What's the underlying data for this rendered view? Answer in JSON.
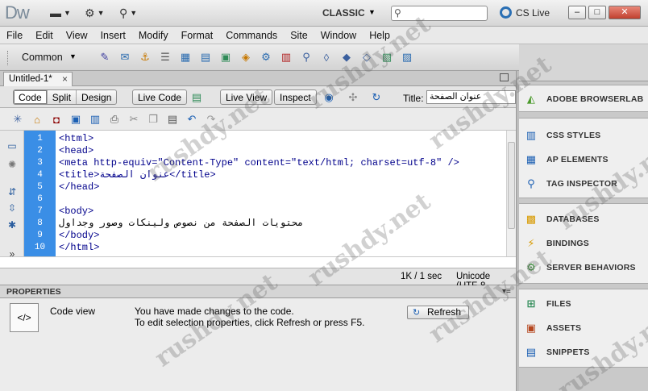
{
  "app": {
    "logo": "Dw",
    "workspace": "CLASSIC",
    "cs_live": "CS Live",
    "search_placeholder": ""
  },
  "menu": [
    "File",
    "Edit",
    "View",
    "Insert",
    "Modify",
    "Format",
    "Commands",
    "Site",
    "Window",
    "Help"
  ],
  "insert_bar": {
    "category": "Common"
  },
  "document": {
    "tab_name": "Untitled-1*",
    "view_buttons": [
      "Code",
      "Split",
      "Design"
    ],
    "active_view": "Code",
    "live_code": "Live Code",
    "live_view": "Live View",
    "inspect": "Inspect",
    "title_label": "Title:",
    "title_value": "عنوان الصفحة"
  },
  "code_lines": [
    {
      "n": "1",
      "text": "<html>"
    },
    {
      "n": "2",
      "text": "<head>"
    },
    {
      "n": "3",
      "text": "<meta http-equiv=\"Content-Type\" content=\"text/html; charset=utf-8\" />"
    },
    {
      "n": "4",
      "text": "<title>عنوان الصفحة</title>"
    },
    {
      "n": "5",
      "text": "</head>"
    },
    {
      "n": "6",
      "text": ""
    },
    {
      "n": "7",
      "text": "<body>"
    },
    {
      "n": "8",
      "text": "محتويات الصفحة من نصوص ولينكات وصور وجداول"
    },
    {
      "n": "9",
      "text": "</body>"
    },
    {
      "n": "10",
      "text": "</html>"
    }
  ],
  "status": {
    "size": "1K / 1 sec",
    "encoding": "Unicode (UTF-8"
  },
  "properties": {
    "header": "PROPERTIES",
    "mode": "Code view",
    "message_1": "You have made changes to the code.",
    "message_2": "To edit selection properties, click Refresh or press F5.",
    "refresh": "Refresh"
  },
  "panels": {
    "group1": [
      "ADOBE BROWSERLAB"
    ],
    "group2": [
      "CSS STYLES",
      "AP ELEMENTS",
      "TAG INSPECTOR"
    ],
    "group3": [
      "DATABASES",
      "BINDINGS",
      "SERVER BEHAVIORS"
    ],
    "group4": [
      "FILES",
      "ASSETS",
      "SNIPPETS"
    ]
  },
  "watermark": "rushdy.net"
}
